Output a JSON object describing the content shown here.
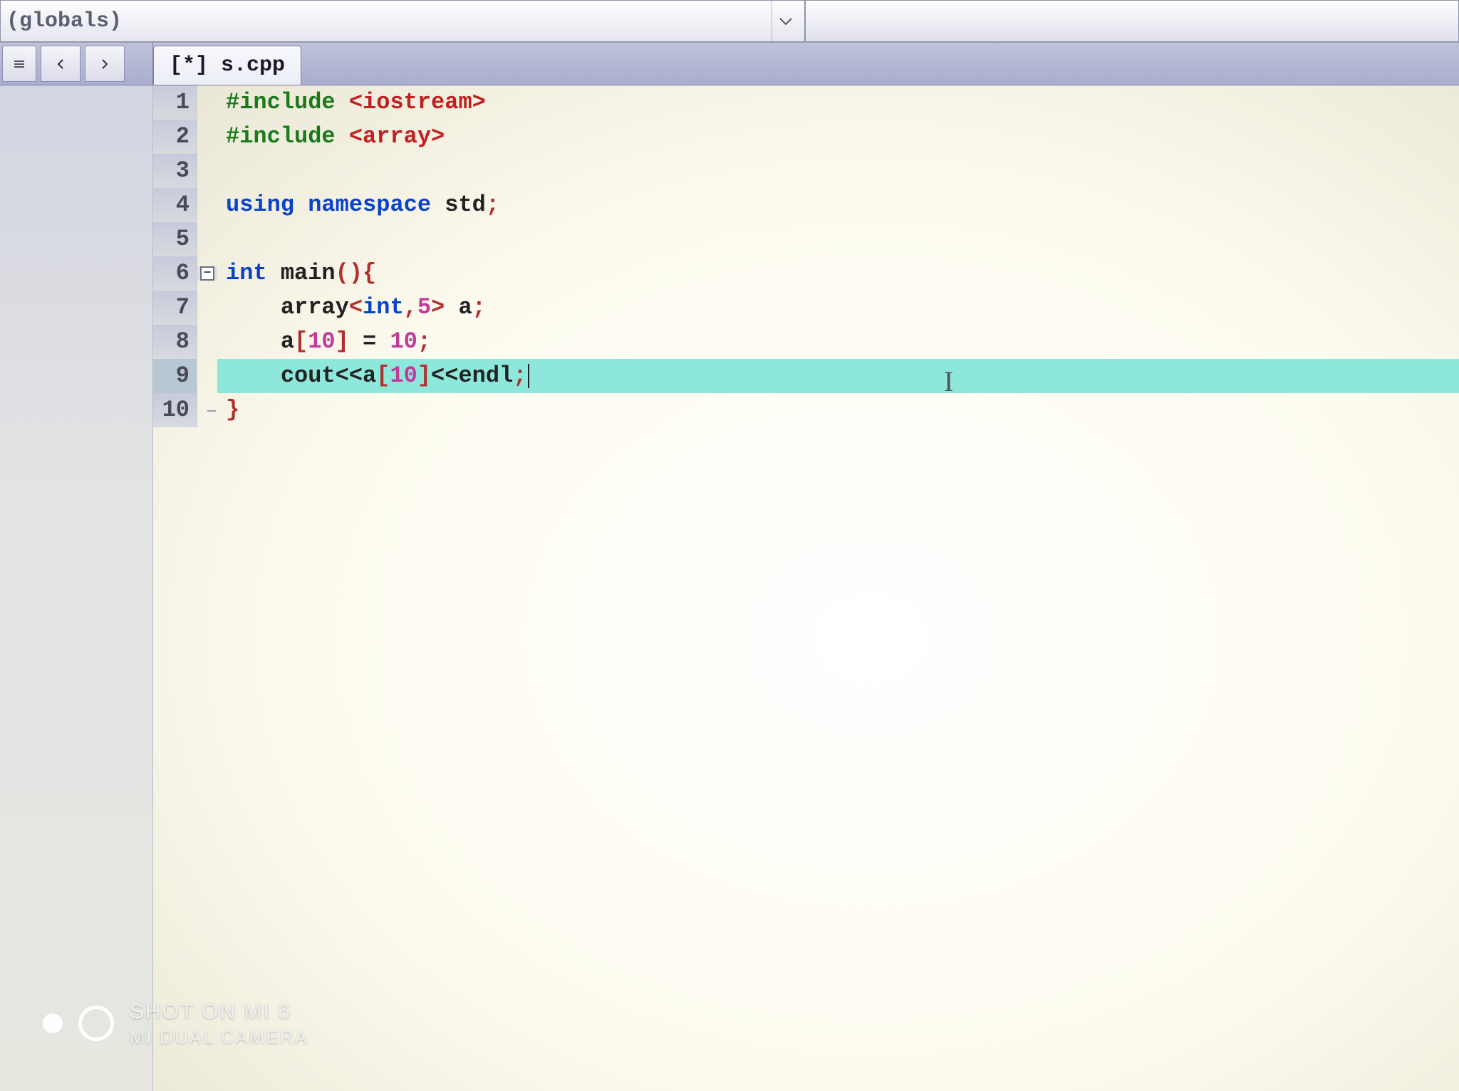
{
  "top": {
    "combo_label": "(globals)"
  },
  "tab": {
    "filename": "[*] s.cpp"
  },
  "gutter": [
    "1",
    "2",
    "3",
    "4",
    "5",
    "6",
    "7",
    "8",
    "9",
    "10"
  ],
  "code": {
    "l1": {
      "pre": "#include ",
      "sys": "<iostream>"
    },
    "l2": {
      "pre": "#include ",
      "sys": "<array>"
    },
    "l3": {
      "blank": ""
    },
    "l4": {
      "kw1": "using ",
      "kw2": "namespace ",
      "ident": "std",
      "semi": ";"
    },
    "l5": {
      "blank": ""
    },
    "l6": {
      "kw": "int ",
      "ident": "main",
      "paren": "()",
      "brace": "{"
    },
    "l7": {
      "indent": "    ",
      "ident1": "array",
      "lt": "<",
      "type": "int",
      "comma": ",",
      "num": "5",
      "gt": ">",
      "sp": " ",
      "ident2": "a",
      "semi": ";"
    },
    "l8": {
      "indent": "    ",
      "ident1": "a",
      "lb": "[",
      "idx": "10",
      "rb": "]",
      "sp1": " ",
      "eq": "=",
      "sp2": " ",
      "val": "10",
      "semi": ";"
    },
    "l9": {
      "indent": "    ",
      "ident1": "cout",
      "op1": "<<",
      "ident2": "a",
      "lb": "[",
      "idx": "10",
      "rb": "]",
      "op2": "<<",
      "ident3": "endl",
      "semi": ";"
    },
    "l10": {
      "brace": "}"
    }
  },
  "fold": {
    "open_glyph": "−"
  },
  "watermark": {
    "line1": "SHOT ON MI 6",
    "line2": "MI DUAL CAMERA"
  },
  "ibeam_glyph": "I"
}
